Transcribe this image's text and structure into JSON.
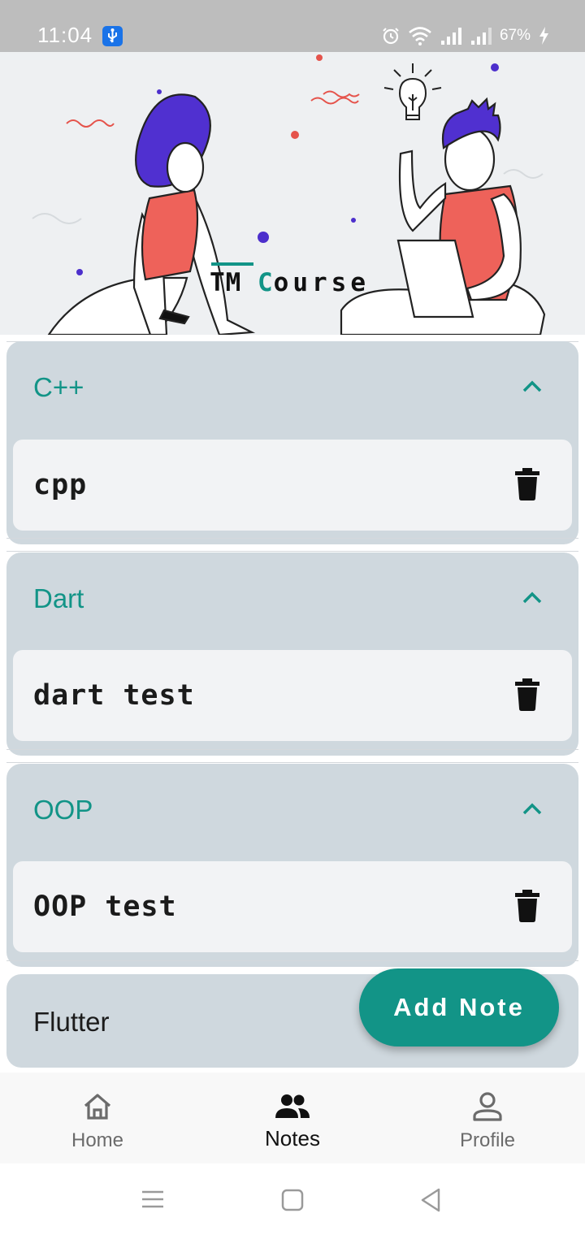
{
  "status_bar": {
    "time": "11:04",
    "battery": "67%",
    "icons": [
      "usb-debug-icon",
      "alarm-icon",
      "wifi-icon",
      "signal-icon",
      "signal-icon",
      "charging-icon"
    ]
  },
  "hero": {
    "brand_prefix": "TM ",
    "brand_accent": "C",
    "brand_rest": "ourse",
    "accent_color": "#129487"
  },
  "sections": [
    {
      "title": "C++",
      "expanded": true,
      "notes": [
        {
          "text": "cpp"
        }
      ]
    },
    {
      "title": "Dart",
      "expanded": true,
      "notes": [
        {
          "text": "dart test"
        }
      ]
    },
    {
      "title": "OOP",
      "expanded": true,
      "notes": [
        {
          "text": "OOP test"
        }
      ]
    },
    {
      "title": "Flutter",
      "expanded": false,
      "notes": []
    }
  ],
  "fab": {
    "label": "Add Note"
  },
  "bottom_nav": {
    "items": [
      {
        "label": "Home",
        "icon": "home-icon",
        "active": false
      },
      {
        "label": "Notes",
        "icon": "people-icon",
        "active": true
      },
      {
        "label": "Profile",
        "icon": "person-icon",
        "active": false
      }
    ]
  },
  "colors": {
    "accent": "#129487",
    "section_bg": "#cfd8de",
    "card_bg": "#f2f3f5",
    "title_active": "#129487",
    "title_collapsed": "#1b1b1b"
  }
}
